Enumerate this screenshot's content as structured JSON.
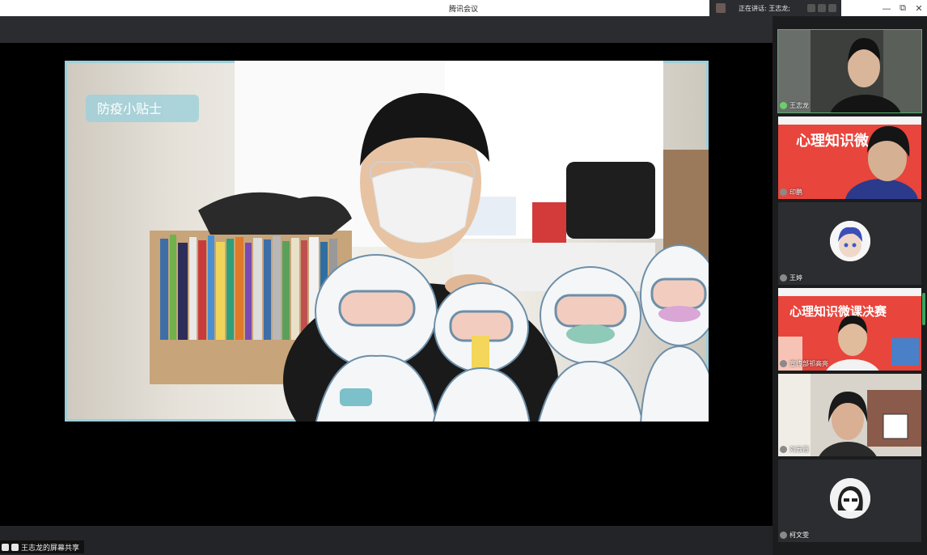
{
  "window": {
    "title": "腾讯会议"
  },
  "speaking": {
    "text": "正在讲话: 王志龙;"
  },
  "winctl": {
    "minimize": "—",
    "restore": "⧉",
    "close": "✕"
  },
  "share_label": {
    "text": "王志龙的屏幕共享"
  },
  "shared_content": {
    "board_text": "防疫小贴士"
  },
  "participants": [
    {
      "name": "王志龙",
      "active": true
    },
    {
      "name": "印鹏",
      "slide_title": "心理知识微"
    },
    {
      "name": "王婷"
    },
    {
      "name": "宣传部祁高亮",
      "slide_title": "心理知识微课决赛"
    },
    {
      "name": "刘云霞"
    },
    {
      "name": "柯文雯"
    }
  ]
}
